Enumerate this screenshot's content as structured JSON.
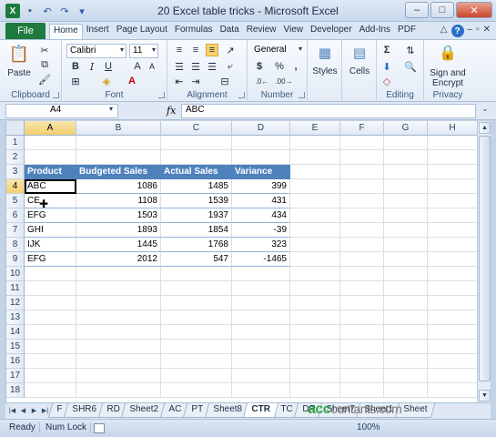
{
  "window": {
    "title": "20 Excel table tricks - Microsoft Excel"
  },
  "tabs": [
    "Home",
    "Insert",
    "Page Layout",
    "Formulas",
    "Data",
    "Review",
    "View",
    "Developer",
    "Add-Ins",
    "PDF"
  ],
  "file_tab": "File",
  "ribbon": {
    "clipboard": {
      "label": "Clipboard",
      "paste": "Paste"
    },
    "font": {
      "label": "Font",
      "name": "Calibri",
      "size": "11"
    },
    "alignment": {
      "label": "Alignment"
    },
    "number": {
      "label": "Number",
      "format": "General"
    },
    "styles": {
      "label": "Styles"
    },
    "cells": {
      "label": "Cells"
    },
    "editing": {
      "label": "Editing"
    },
    "privacy": {
      "label": "Privacy",
      "sign": "Sign and",
      "encrypt": "Encrypt"
    }
  },
  "formula_bar": {
    "name_box": "A4",
    "fx": "fx",
    "content": "ABC"
  },
  "columns": [
    "A",
    "B",
    "C",
    "D",
    "E",
    "F",
    "G",
    "H"
  ],
  "rows": [
    "1",
    "2",
    "3",
    "4",
    "5",
    "6",
    "7",
    "8",
    "9",
    "10",
    "11",
    "12",
    "13",
    "14",
    "15",
    "16",
    "17",
    "18"
  ],
  "table": {
    "headers": [
      "Product",
      "Budgeted Sales",
      "Actual Sales",
      "Variance"
    ],
    "rows": [
      [
        "ABC",
        "1086",
        "1485",
        "399"
      ],
      [
        "CE",
        "1108",
        "1539",
        "431"
      ],
      [
        "EFG",
        "1503",
        "1937",
        "434"
      ],
      [
        "GHI",
        "1893",
        "1854",
        "-39"
      ],
      [
        "IJK",
        "1445",
        "1768",
        "323"
      ],
      [
        "EFG",
        "2012",
        "547",
        "-1465"
      ]
    ]
  },
  "sheets": [
    "F",
    "SHR6",
    "RD",
    "Sheet2",
    "AC",
    "PT",
    "Sheet8",
    "CTR",
    "TC",
    "DR",
    "Sheet7",
    "Sheet1",
    "Sheet"
  ],
  "active_sheet": "CTR",
  "status": {
    "ready": "Ready",
    "num_lock": "Num Lock",
    "zoom": "100%"
  },
  "watermark": {
    "brand": "acc",
    "rest": "ountants.com"
  },
  "colors": {
    "table_header": "#4f81bd",
    "file_tab": "#1f7a3d"
  }
}
